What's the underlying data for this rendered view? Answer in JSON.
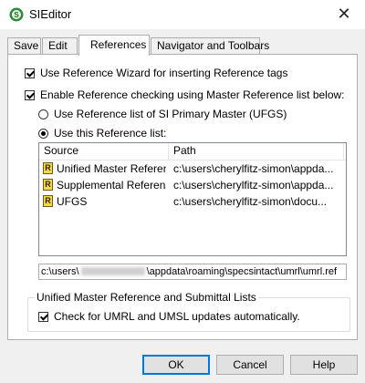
{
  "window": {
    "title": "SIEditor",
    "close_label": "✕"
  },
  "tabs": [
    {
      "label": "Save"
    },
    {
      "label": "Edit"
    },
    {
      "label": "References"
    },
    {
      "label": "Navigator and Toolbars"
    }
  ],
  "options": {
    "use_wizard": "Use Reference Wizard for inserting Reference tags",
    "enable_checking": "Enable Reference checking using Master Reference list below:",
    "radio_primary": "Use Reference list of SI Primary Master (UFGS)",
    "radio_this": "Use this Reference list:"
  },
  "list": {
    "columns": [
      "Source",
      "Path"
    ],
    "rows": [
      {
        "source": "Unified Master Referen...",
        "path": "c:\\users\\cherylfitz-simon\\appda..."
      },
      {
        "source": "Supplemental Referen...",
        "path": "c:\\users\\cherylfitz-simon\\appda..."
      },
      {
        "source": "UFGS",
        "path": "c:\\users\\cherylfitz-simon\\docu..."
      }
    ]
  },
  "path_field": {
    "prefix": "c:\\users\\",
    "suffix": "\\appdata\\roaming\\specsintact\\umrl\\umrl.ref"
  },
  "group": {
    "title": "Unified Master Reference and Submittal Lists",
    "check_updates": "Check for UMRL and UMSL updates automatically."
  },
  "buttons": {
    "ok": "OK",
    "cancel": "Cancel",
    "help": "Help"
  }
}
